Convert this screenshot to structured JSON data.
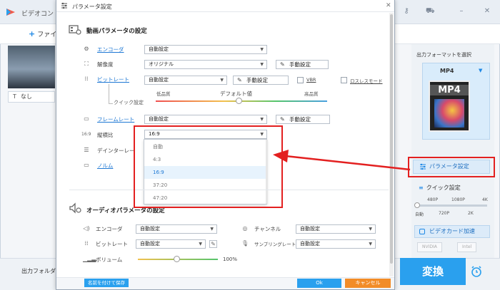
{
  "app": {
    "title": "ビデオコン",
    "add_file": "ファイ",
    "subtitle_value": "なし",
    "output_folder_label": "出力フォルダ：",
    "convert_label": "変換",
    "brand_color": "#2aa0ee"
  },
  "right_panel": {
    "title": "出力フォーマットを選択",
    "format_name": "MP4",
    "format_image_label": "MP4",
    "param_button": "パラメータ設定",
    "quick_title": "クイック設定",
    "quick_top": [
      "480P",
      "1080P",
      "4K"
    ],
    "quick_bottom": [
      "自動",
      "720P",
      "2K"
    ],
    "quick_level": 0,
    "gpu_button": "ビデオカード加速",
    "gpu_badges": [
      "NVIDIA",
      "Intel"
    ]
  },
  "dialog": {
    "title": "パラメータ設定",
    "video_section": "動画パラメータの設定",
    "encoder_label": "エンコーダ",
    "encoder_value": "自動設定",
    "resolution_label": "解像度",
    "resolution_value": "オリジナル",
    "manual_label": "手動設定",
    "bitrate_label": "ビットレート",
    "bitrate_value": "自動設定",
    "vbr_label": "VBR",
    "lossless_label": "ロスレスモード",
    "quick_setting": "クイック設定",
    "low_quality": "低品質",
    "default_value": "デフォルト値",
    "high_quality": "高品質",
    "framerate_label": "フレームレート",
    "framerate_value": "自動設定",
    "aspect_label": "縦横比",
    "aspect_value": "16:9",
    "deinterlace_label": "デインターレー",
    "norm_label": "ノルム",
    "aspect_options": [
      "自動",
      "4:3",
      "16:9",
      "37:20",
      "47:20"
    ],
    "aspect_selected_index": 2,
    "audio_section": "オーディオパラメータの設定",
    "a_encoder_label": "エンコーダ",
    "a_encoder_value": "自動設定",
    "channel_label": "チャンネル",
    "channel_value": "自動設定",
    "a_bitrate_label": "ビットレート",
    "a_bitrate_value": "自動設定",
    "samplerate_label": "サンプリングレート",
    "samplerate_value": "自動設定",
    "volume_label": "ボリューム",
    "volume_value": "100%",
    "save_as_button": "名前を付けて保存",
    "ok_button": "Ok",
    "cancel_button": "キャンセル"
  }
}
